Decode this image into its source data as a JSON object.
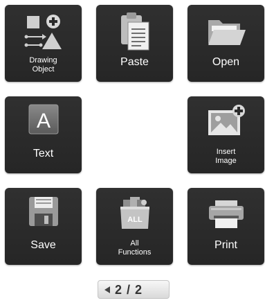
{
  "tiles": {
    "drawing_object": {
      "label": "Drawing\nObject",
      "icon": "drawing-object-icon"
    },
    "paste": {
      "label": "Paste",
      "icon": "clipboard-icon"
    },
    "open": {
      "label": "Open",
      "icon": "folder-icon"
    },
    "text": {
      "label": "Text",
      "icon": "text-a-icon"
    },
    "insert_image": {
      "label": "Insert\nImage",
      "icon": "insert-image-icon"
    },
    "save": {
      "label": "Save",
      "icon": "floppy-disk-icon"
    },
    "all_functions": {
      "label": "All\nFunctions",
      "icon": "all-functions-icon",
      "icon_text": "ALL"
    },
    "print": {
      "label": "Print",
      "icon": "printer-icon"
    }
  },
  "pager": {
    "text": "2 / 2",
    "icon": "prev-page-arrow-icon"
  },
  "colors": {
    "tile_bg": "#2b2b2b",
    "tile_text": "#ffffff",
    "icon_light": "#d8d8d8",
    "page_bg": "#ffffff"
  }
}
